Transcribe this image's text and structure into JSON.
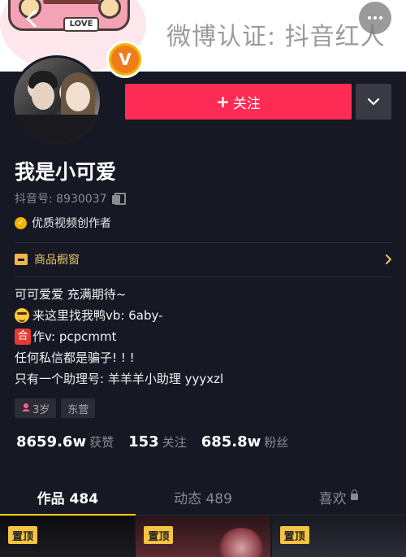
{
  "banner": {
    "text": "微博认证: 抖音红人",
    "love_plate": "LOVE"
  },
  "profile": {
    "verify_mark": "V",
    "follow_label": "关注",
    "follow_plus": "+",
    "nickname": "我是小可爱",
    "douyin_id": "抖音号: 8930037",
    "quality_label": "优质视频创作者",
    "shop_label": "商品橱窗"
  },
  "bio": {
    "line1": "可可爱爱 充满期待~",
    "line2": "来这里找我鸭vb: 6aby-",
    "line3_badge": "合",
    "line3": "作v: pcpcmmt",
    "line4": "任何私信都是骗子! ! !",
    "line5": "只有一个助理号: 羊羊羊小助理 yyyxzl"
  },
  "tags": {
    "age": "3岁",
    "location": "东营"
  },
  "stats": {
    "likes_num": "8659.6w",
    "likes_label": "获赞",
    "following_num": "153",
    "following_label": "关注",
    "fans_num": "685.8w",
    "fans_label": "粉丝"
  },
  "tabs": {
    "works": "作品 484",
    "moments": "动态 489",
    "likes": "喜欢"
  },
  "grid": {
    "pin_label": "置顶"
  },
  "colors": {
    "background": "#161823",
    "follow": "#fe2c55",
    "tab_indicator": "#face15",
    "badge": "#f6c342"
  }
}
